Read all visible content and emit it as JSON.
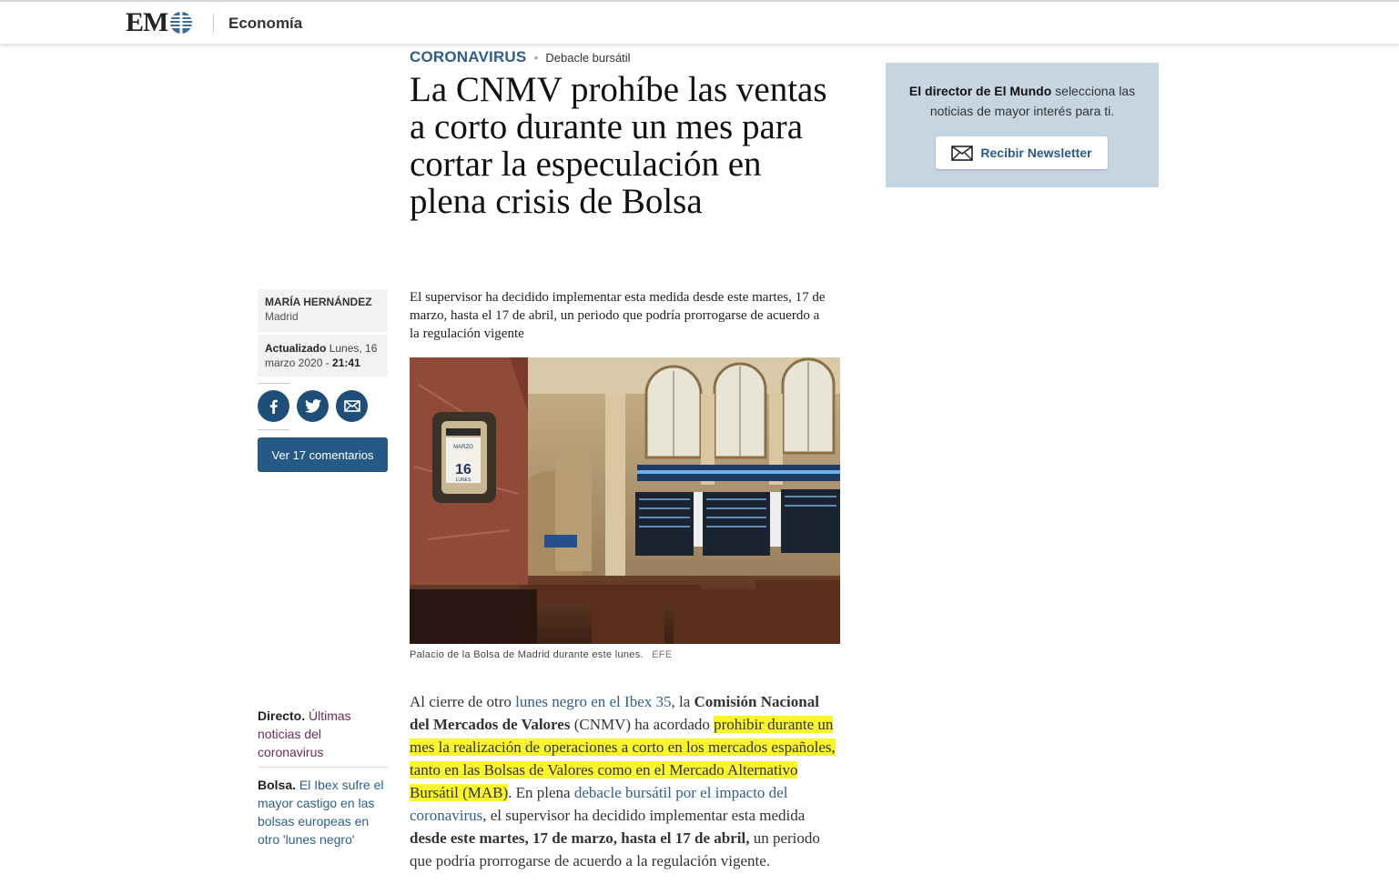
{
  "header": {
    "logo_text": "EM",
    "section": "Economía"
  },
  "article": {
    "kicker": "CORONAVIRUS",
    "subkicker": "Debacle bursátil",
    "title": "La CNMV prohíbe las ventas a corto durante un mes para cortar la especulación en plena crisis de Bolsa",
    "summary": "El supervisor ha decidido implementar esta medida desde este martes, 17 de marzo, hasta el 17 de abril, un periodo que podría prorrogarse de acuerdo a la regulación vigente",
    "author": "MARÍA HERNÁNDEZ",
    "location": "Madrid",
    "updated_label": "Actualizado",
    "updated_date": "Lunes, 16 marzo 2020 -",
    "updated_time": "21:41",
    "comments_button": "Ver 17 comentarios",
    "image_caption": "Palacio de la Bolsa de Madrid durante este lunes.",
    "image_credit": "EFE",
    "body": {
      "t1": "Al cierre de otro ",
      "link1": "lunes negro en el Ibex 35",
      "t2": ", la ",
      "bold1": "Comisión Nacional del Mercados de Valores",
      "t3": " (CNMV) ha acordado ",
      "highlight": "prohibir durante un mes la realización de operaciones a corto en los mercados españoles, tanto en las Bolsas de Valores como en el Mercado Alternativo Bursátil (MAB)",
      "t4": ". En plena ",
      "link2": "debacle bursátil por el impacto del coronavirus",
      "t5": ", el supervisor ha decidido implementar esta medida ",
      "bold2": "desde este martes, 17 de marzo, hasta el 17 de abril,",
      "t6": " un periodo que podría prorrogarse de acuerdo a la regulación vigente."
    }
  },
  "social": {
    "icons": [
      "facebook-icon",
      "twitter-icon",
      "email-icon"
    ]
  },
  "related": [
    {
      "label": "Directo.",
      "link": "Últimas noticias del coronavirus"
    },
    {
      "label": "Bolsa.",
      "link": "El Ibex sufre el mayor castigo en las bolsas europeas en otro 'lunes negro'"
    }
  ],
  "newsletter": {
    "text_bold": "El director de El Mundo",
    "text_rest": " selecciona las noticias de mayor interés para ti.",
    "button": "Recibir Newsletter"
  },
  "colors": {
    "brand_blue": "#245a85",
    "highlight": "#fbf52d",
    "newsletter_bg": "#c6d5e2"
  }
}
